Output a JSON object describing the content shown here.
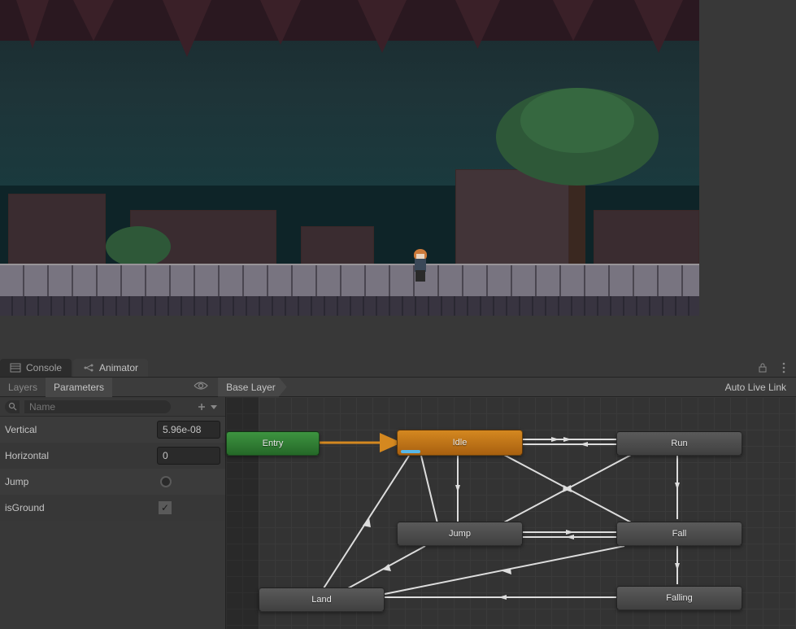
{
  "tabs": {
    "console": "Console",
    "animator": "Animator"
  },
  "sub_tabs": {
    "layers": "Layers",
    "parameters": "Parameters"
  },
  "breadcrumb": "Base Layer",
  "auto_live_link": "Auto Live Link",
  "search": {
    "placeholder": "Name"
  },
  "params": [
    {
      "name": "Vertical",
      "type": "float",
      "value": "5.96e-08"
    },
    {
      "name": "Horizontal",
      "type": "float",
      "value": "0"
    },
    {
      "name": "Jump",
      "type": "trigger",
      "value": ""
    },
    {
      "name": "isGround",
      "type": "bool",
      "value": "true"
    }
  ],
  "nodes": {
    "entry": "Entry",
    "idle": "Idle",
    "run": "Run",
    "jump": "Jump",
    "fall": "Fall",
    "land": "Land",
    "falling": "Falling"
  },
  "colors": {
    "entry": "#2e8a30",
    "default": "#c07818",
    "gray": "#4a4a4a",
    "transition_active": "#d48820"
  }
}
